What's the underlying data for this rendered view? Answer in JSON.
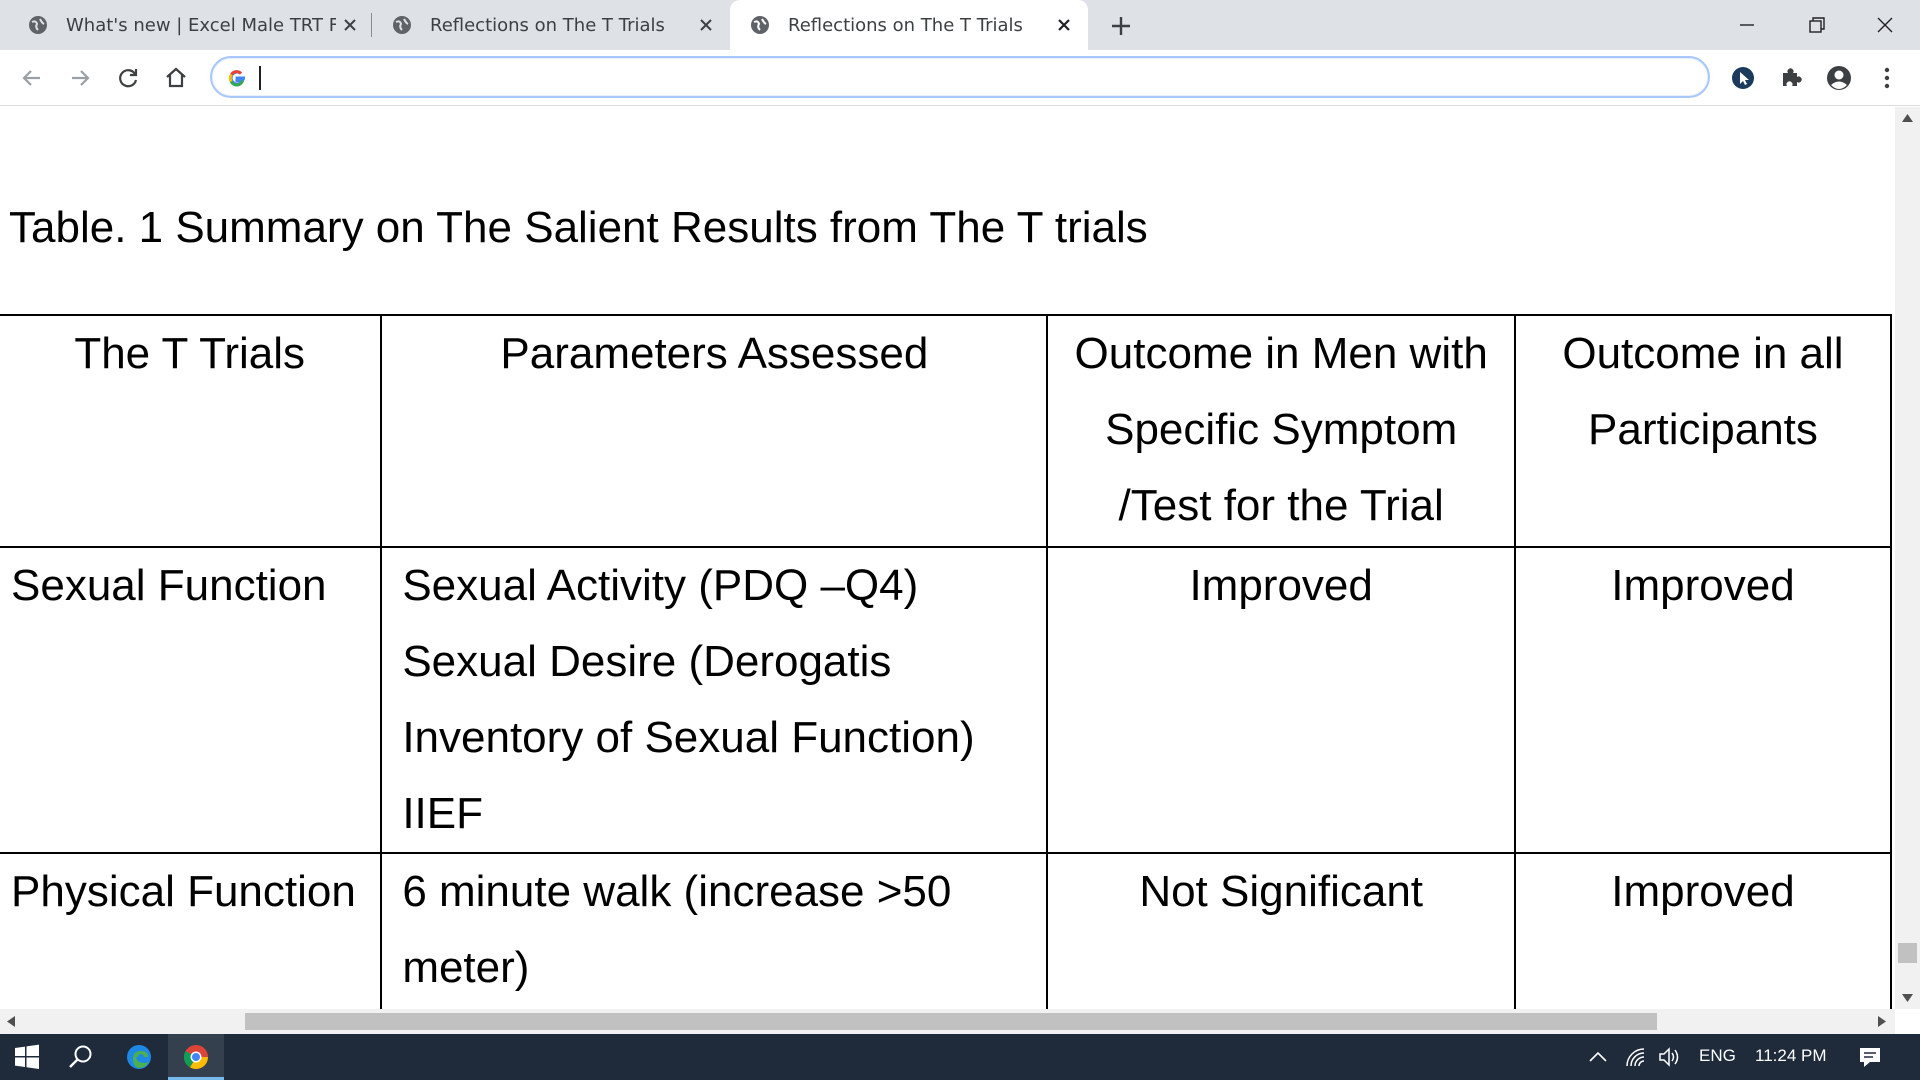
{
  "browser": {
    "tabs": [
      {
        "title": "What's new | Excel Male TRT Foru",
        "active": false
      },
      {
        "title": "Reflections on The T Trials",
        "active": false
      },
      {
        "title": "Reflections on The T Trials",
        "active": true
      }
    ],
    "new_tab_label": "+",
    "address_bar": {
      "value": "",
      "placeholder": ""
    },
    "toolbar_icons": [
      "back-icon",
      "forward-icon",
      "reload-icon",
      "home-icon",
      "google-icon",
      "extension-cursor-icon",
      "puzzle-icon",
      "profile-icon",
      "menu-icon"
    ]
  },
  "document": {
    "title": "Table. 1 Summary on The Salient Results from The T trials",
    "table": {
      "headers": [
        [
          "The T Trials"
        ],
        [
          "Parameters Assessed"
        ],
        [
          "Outcome in Men with",
          "Specific Symptom",
          "/Test for the Trial"
        ],
        [
          "Outcome in all",
          "Participants"
        ]
      ],
      "rows": [
        {
          "trial": "Sexual Function",
          "parameters": [
            "Sexual Activity (PDQ –Q4)",
            "Sexual Desire (Derogatis",
            "Inventory of Sexual Function)",
            "IIEF"
          ],
          "outcome_specific": "Improved",
          "outcome_all": "Improved"
        },
        {
          "trial": "Physical Function",
          "parameters": [
            "6 minute walk (increase >50",
            "meter)"
          ],
          "outcome_specific": "Not Significant",
          "outcome_all": "Improved"
        }
      ]
    }
  },
  "taskbar": {
    "apps": [
      "windows-start-icon",
      "search-icon",
      "edge-icon",
      "chrome-icon"
    ],
    "tray": {
      "language": "ENG",
      "time": "11:24 PM"
    }
  },
  "colors": {
    "tab_strip": "#dee1e6",
    "taskbar": "#1f2a3a",
    "omnibox_border": "#a8c7fa"
  }
}
